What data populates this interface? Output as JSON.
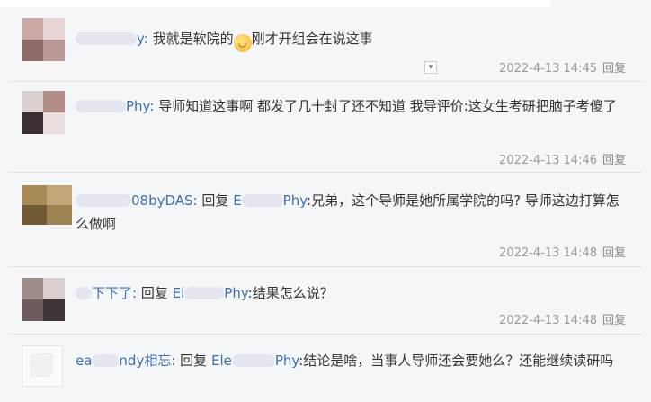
{
  "comments": [
    {
      "user_visible": "y:",
      "text": "我就是软院的",
      "emoji": "smile-emoji",
      "text2": "刚才开组会在说这事",
      "time": "2022-4-13 14:45",
      "reply": "回复"
    },
    {
      "user_visible": "Phy:",
      "text": "导师知道这事啊 都发了几十封了还不知道 我导评价:这女生考研把脑子考傻了",
      "time": "2022-4-13 14:46",
      "reply": "回复"
    },
    {
      "user_visible": "08byDAS:",
      "reply_word": "回复",
      "target_a": "E",
      "target_b": "Phy",
      "text": ":兄弟，这个导师是她所属学院的吗? 导师这边打算怎么做啊",
      "time": "2022-4-13 14:48",
      "reply": "回复"
    },
    {
      "user_visible": "下下了:",
      "reply_word": "回复",
      "target_a": "El",
      "target_b": "Phy",
      "text": ":结果怎么说？",
      "time": "2022-4-13 14:48",
      "reply": "回复"
    },
    {
      "user_visible_a": "ea",
      "user_visible_b": "ndy相忘:",
      "reply_word": "回复",
      "target_a": "Ele",
      "target_b": "Phy",
      "text": ":结论是啥，当事人导师还会要她么？还能继续读研吗"
    }
  ],
  "colors": {
    "username": "#3b6fb6",
    "meta": "#9a9a9a",
    "background": "#f5f6f8"
  }
}
